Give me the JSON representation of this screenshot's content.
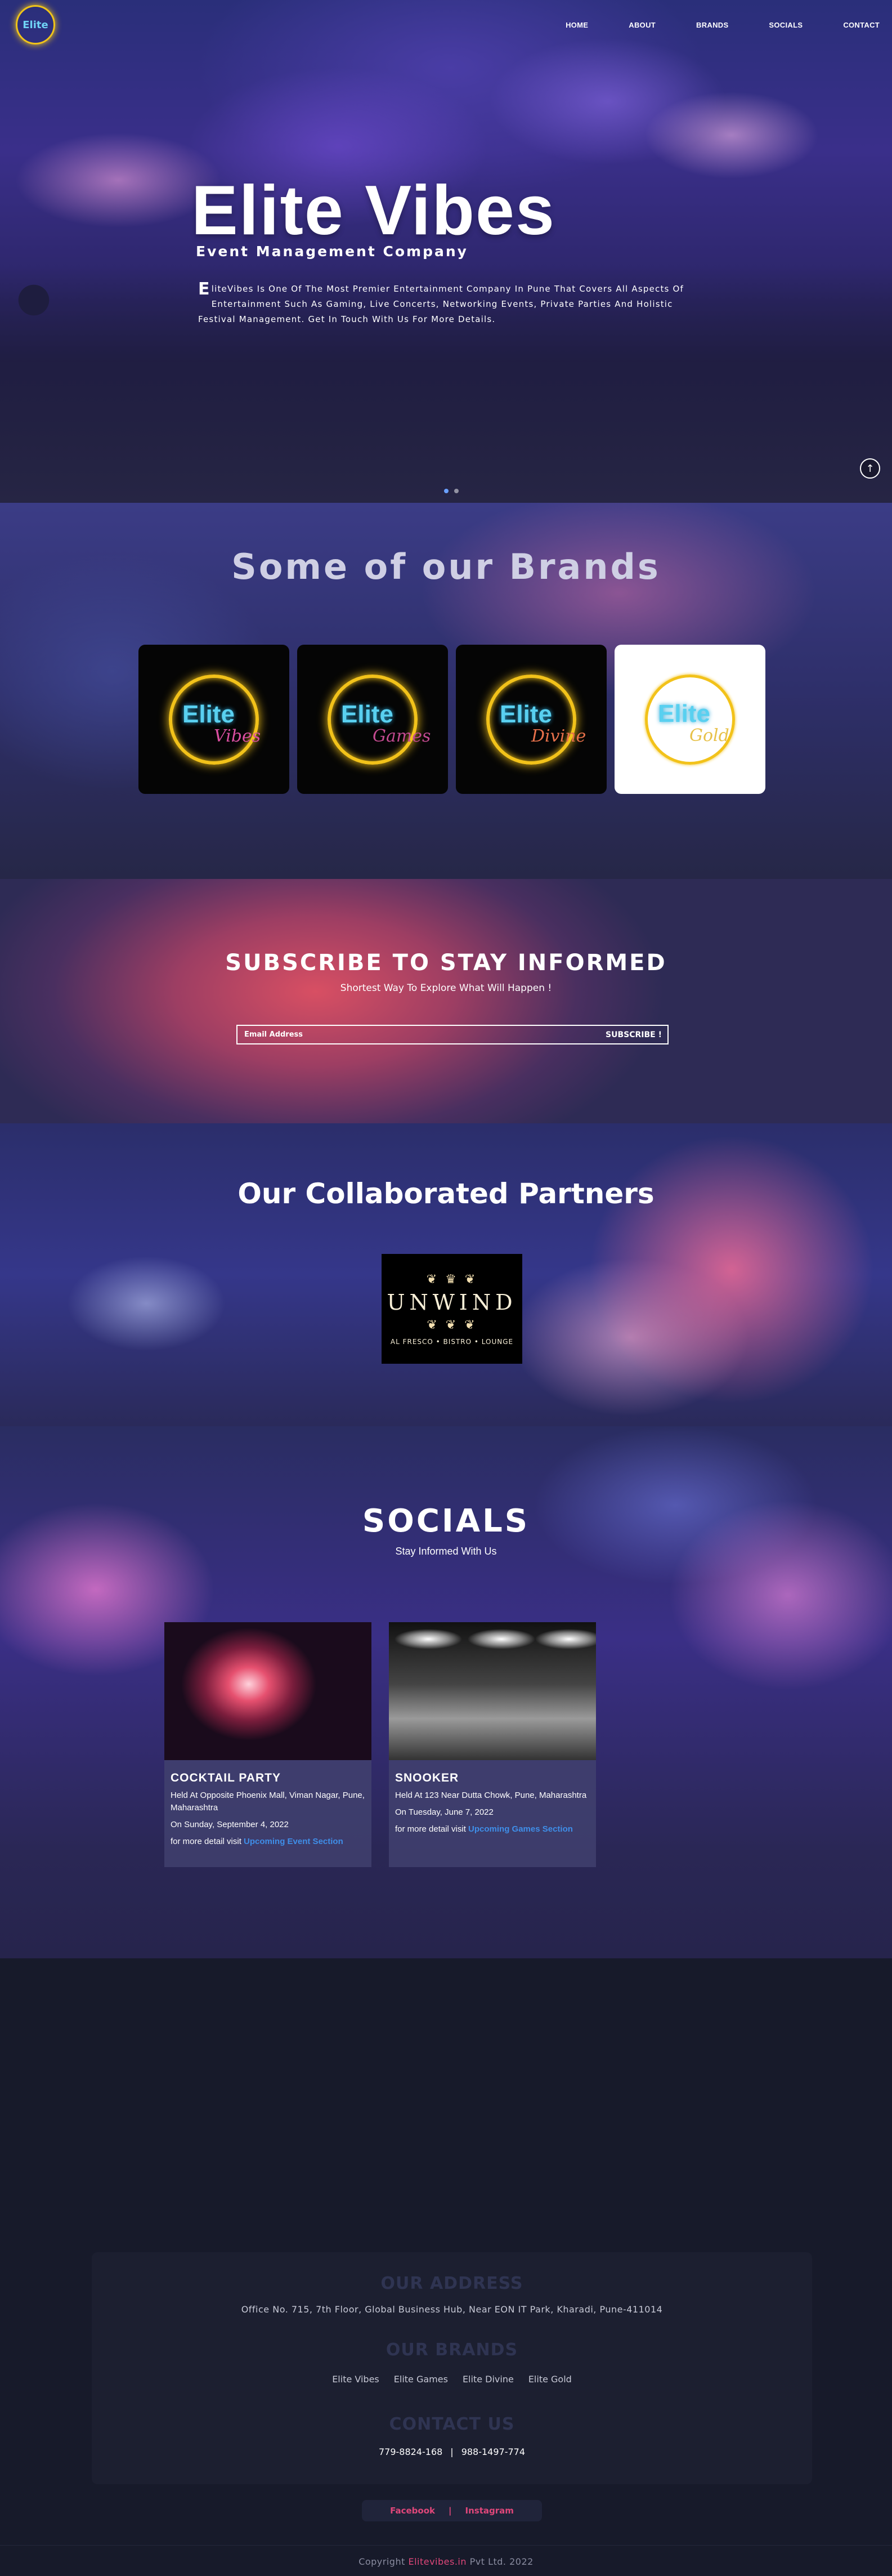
{
  "nav": {
    "logo_text": "Elite",
    "links": [
      "HOME",
      "ABOUT",
      "BRANDS",
      "SOCIALS",
      "CONTACT"
    ]
  },
  "hero": {
    "title": "Elite Vibes",
    "subtitle": "Event Management Company",
    "dropcap": "E",
    "description": "liteVibes Is One Of The Most Premier Entertainment Company In Pune That Covers All Aspects Of Entertainment Such As Gaming, Live Concerts, Networking Events, Private Parties And Holistic Festival Management. Get In Touch With Us For More Details.",
    "scroll_icon": "arrow-up-icon"
  },
  "brands": {
    "title": "Some of our Brands",
    "items": [
      {
        "main": "Elite",
        "sub": "Vibes",
        "sub_color": "#d94fa0",
        "bg": "#050505"
      },
      {
        "main": "Elite",
        "sub": "Games",
        "sub_color": "#c24a8f",
        "bg": "#050505"
      },
      {
        "main": "Elite",
        "sub": "Divine",
        "sub_color": "#e6704a",
        "bg": "#050505"
      },
      {
        "main": "Elite",
        "sub": "Gold",
        "sub_color": "#e7c14a",
        "bg": "#ffffff"
      }
    ]
  },
  "subscribe": {
    "title": "SUBSCRIBE TO STAY INFORMED",
    "text": "Shortest Way To Explore What Will Happen !",
    "placeholder": "Email Address",
    "button": "SUBSCRIBE !"
  },
  "partners": {
    "title": "Our Collaborated Partners",
    "logo_name": "UNWIND",
    "logo_tag": "AL FRESCO • BISTRO • LOUNGE"
  },
  "socials": {
    "title": "SOCIALS",
    "subtitle": "Stay Informed With Us",
    "events": [
      {
        "title": "COCKTAIL PARTY",
        "location": "Held At Opposite Phoenix Mall, Viman Nagar, Pune, Maharashtra",
        "date": "On Sunday, September 4, 2022",
        "more_prefix": "for more detail visit ",
        "more_link": "Upcoming Event Section"
      },
      {
        "title": "SNOOKER",
        "location": "Held At 123 Near Dutta Chowk, Pune, Maharashtra",
        "date": "On Tuesday, June 7, 2022",
        "more_prefix": "for more detail visit ",
        "more_link": "Upcoming Games Section"
      }
    ]
  },
  "footer": {
    "address_heading": "OUR ADDRESS",
    "address": "Office No. 715, 7th Floor, Global Business Hub, Near EON IT Park, Kharadi, Pune-411014",
    "brands_heading": "OUR BRANDS",
    "brands": [
      "Elite Vibes",
      "Elite Games",
      "Elite Divine",
      "Elite Gold"
    ],
    "contact_heading": "CONTACT US",
    "phone1": "779-8824-168",
    "divider": "|",
    "phone2": "988-1497-774",
    "social_facebook": "Facebook",
    "social_divider": "|",
    "social_instagram": "Instagram",
    "copyright_prefix": "Copyright ",
    "copyright_company": "Elitevibes.in",
    "copyright_suffix": " Pvt Ltd. 2022"
  }
}
